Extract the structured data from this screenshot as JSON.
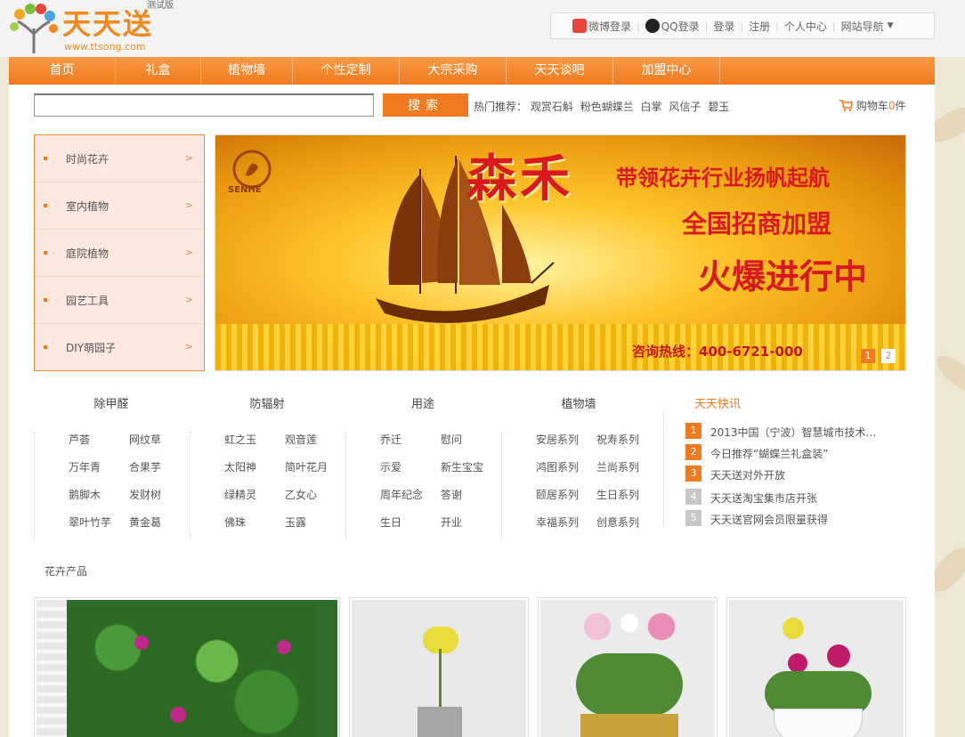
{
  "logo": {
    "title": "天天送",
    "badge": "测试版",
    "url": "www.ttsong.com"
  },
  "toplinks": {
    "weibo": "微博登录",
    "qq": "QQ登录",
    "login": "登录",
    "register": "注册",
    "account": "个人中心",
    "sitemap": "网站导航"
  },
  "nav": [
    "首页",
    "礼盒",
    "植物墙",
    "个性定制",
    "大宗采购",
    "天天谈吧",
    "加盟中心"
  ],
  "search": {
    "value": "",
    "button": "搜索",
    "hot_label": "热门推荐：",
    "hot": [
      "观赏石斛",
      "粉色蝴蝶兰",
      "白掌",
      "风信子",
      "碧玉"
    ]
  },
  "cart": {
    "label": "购物车",
    "count": "0",
    "unit": "件"
  },
  "categories": [
    "时尚花卉",
    "室内植物",
    "庭院植物",
    "园艺工具",
    "DIY萌园子"
  ],
  "banner": {
    "brand": "SENHE",
    "big": "森禾",
    "line1": "带领花卉行业扬帆起航",
    "line2": "全国招商加盟",
    "line3": "火爆进行中",
    "hotline": "咨询热线：400-6721-000",
    "pages": [
      "1",
      "2"
    ]
  },
  "columns": [
    {
      "title": "除甲醛",
      "items": [
        "芦荟",
        "网纹草",
        "万年青",
        "合果芋",
        "鹅脚木",
        "发财树",
        "翠叶竹芋",
        "黄金葛"
      ]
    },
    {
      "title": "防辐射",
      "items": [
        "虹之玉",
        "观音莲",
        "太阳神",
        "简叶花月",
        "绿精灵",
        "乙女心",
        "佛珠",
        "玉露"
      ]
    },
    {
      "title": "用途",
      "items": [
        "乔迁",
        "慰问",
        "示爱",
        "新生宝宝",
        "周年纪念",
        "答谢",
        "生日",
        "开业"
      ]
    },
    {
      "title": "植物墙",
      "items": [
        "安居系列",
        "祝寿系列",
        "鸿图系列",
        "兰尚系列",
        "颐居系列",
        "生日系列",
        "幸福系列",
        "创意系列"
      ]
    }
  ],
  "news": {
    "title": "天天快讯",
    "items": [
      {
        "n": "1",
        "text": "2013中国（宁波）智慧城市技术…"
      },
      {
        "n": "2",
        "text": "今日推荐“蝴蝶兰礼盒装”"
      },
      {
        "n": "3",
        "text": "天天送对外开放"
      },
      {
        "n": "4",
        "text": "天天送淘宝集市店开张"
      },
      {
        "n": "5",
        "text": "天天送官网会员限量获得"
      }
    ]
  },
  "products_section": "花卉产品",
  "colors": {
    "accent": "#ef7a1f",
    "nav": "#f89a45",
    "cat_bg": "#fde9df",
    "banner_red": "#d8191e",
    "news_grey": "#c8c8c8"
  }
}
